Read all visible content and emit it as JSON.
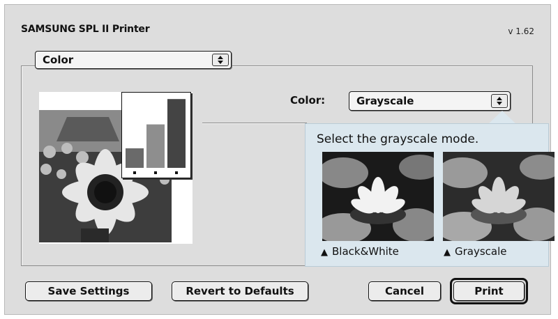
{
  "window": {
    "title": "SAMSUNG SPL II Printer",
    "version": "v 1.62"
  },
  "panel_menu": {
    "selected": "Color",
    "icon": "up-down-arrows-icon"
  },
  "color_option": {
    "label": "Color:",
    "selected": "Grayscale",
    "icon": "up-down-arrows-icon"
  },
  "tooltip": {
    "text": "Select the grayscale mode.",
    "options": [
      {
        "marker": "▲",
        "label": "Black&White"
      },
      {
        "marker": "▲",
        "label": "Grayscale"
      }
    ]
  },
  "preview": {
    "image": "sunflower-photo",
    "chart_icon": "bar-chart-icon",
    "bar_levels": [
      0.27,
      0.6,
      0.95
    ],
    "bar_colors": [
      "#6a6a6a",
      "#8e8e8e",
      "#444444"
    ]
  },
  "buttons": {
    "save": "Save Settings",
    "revert": "Revert to Defaults",
    "cancel": "Cancel",
    "print": "Print"
  },
  "colors": {
    "dialog_bg": "#dddddd",
    "tooltip_bg": "#dbe7ee"
  }
}
